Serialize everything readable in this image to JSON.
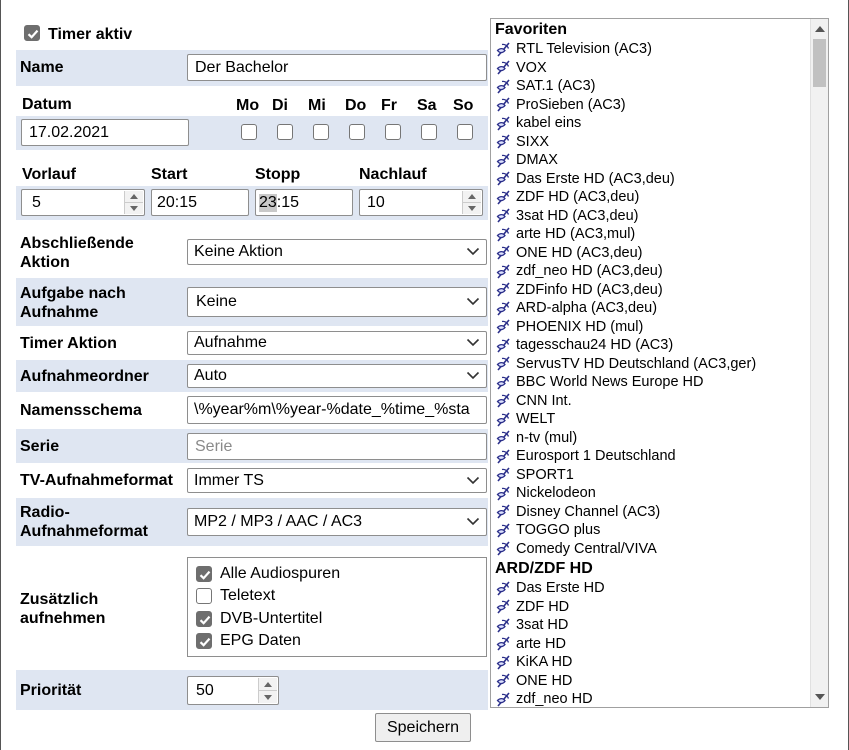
{
  "timer_active": {
    "label": "Timer aktiv",
    "checked": true
  },
  "name": {
    "label": "Name",
    "value": "Der Bachelor"
  },
  "date": {
    "label": "Datum",
    "value": "17.02.2021"
  },
  "days": [
    {
      "label": "Mo",
      "checked": false
    },
    {
      "label": "Di",
      "checked": false
    },
    {
      "label": "Mi",
      "checked": false
    },
    {
      "label": "Do",
      "checked": false
    },
    {
      "label": "Fr",
      "checked": false
    },
    {
      "label": "Sa",
      "checked": false
    },
    {
      "label": "So",
      "checked": false
    }
  ],
  "times": {
    "vorlauf_label": "Vorlauf",
    "vorlauf_value": "5",
    "start_label": "Start",
    "start_value": "20:15",
    "stopp_label": "Stopp",
    "stopp_hour": "23",
    "stopp_rest": ":15",
    "nachlauf_label": "Nachlauf",
    "nachlauf_value": "10"
  },
  "closing_action": {
    "label_line1": "Abschließende",
    "label_line2": "Aktion",
    "value": "Keine Aktion"
  },
  "after_record": {
    "label_line1": "Aufgabe nach",
    "label_line2": "Aufnahme",
    "value": "Keine"
  },
  "timer_action": {
    "label": "Timer Aktion",
    "value": "Aufnahme"
  },
  "record_folder": {
    "label": "Aufnahmeordner",
    "value": "Auto"
  },
  "name_schema": {
    "label": "Namensschema",
    "value": "\\%year%m\\%year-%date_%time_%sta"
  },
  "series": {
    "label": "Serie",
    "placeholder": "Serie"
  },
  "tv_format": {
    "label": "TV-Aufnahmeformat",
    "value": "Immer TS"
  },
  "radio_format": {
    "label_line1": "Radio-",
    "label_line2": "Aufnahmeformat",
    "value": "MP2 / MP3 / AAC / AC3"
  },
  "additional": {
    "label_line1": "Zusätzlich",
    "label_line2": "aufnehmen",
    "options": [
      {
        "label": "Alle Audiospuren",
        "checked": true
      },
      {
        "label": "Teletext",
        "checked": false
      },
      {
        "label": "DVB-Untertitel",
        "checked": true
      },
      {
        "label": "EPG Daten",
        "checked": true
      }
    ]
  },
  "priority": {
    "label": "Priorität",
    "value": "50"
  },
  "save_label": "Speichern",
  "channels": {
    "groups": [
      {
        "name": "Favoriten",
        "items": [
          "RTL Television (AC3)",
          "VOX",
          "SAT.1 (AC3)",
          "ProSieben (AC3)",
          "kabel eins",
          "SIXX",
          "DMAX",
          "Das Erste HD (AC3,deu)",
          "ZDF HD (AC3,deu)",
          "3sat HD (AC3,deu)",
          "arte HD (AC3,mul)",
          "ONE HD (AC3,deu)",
          "zdf_neo HD (AC3,deu)",
          "ZDFinfo HD (AC3,deu)",
          "ARD-alpha (AC3,deu)",
          "PHOENIX HD (mul)",
          "tagesschau24 HD (AC3)",
          "ServusTV HD Deutschland (AC3,ger)",
          "BBC World News Europe HD",
          "CNN Int.",
          "WELT",
          "n-tv (mul)",
          "Eurosport 1 Deutschland",
          "SPORT1",
          "Nickelodeon",
          "Disney Channel (AC3)",
          "TOGGO plus",
          "Comedy Central/VIVA"
        ]
      },
      {
        "name": "ARD/ZDF HD",
        "items": [
          "Das Erste HD",
          "ZDF HD",
          "3sat HD",
          "arte HD",
          "KiKA HD",
          "ONE HD",
          "zdf_neo HD"
        ]
      }
    ]
  }
}
